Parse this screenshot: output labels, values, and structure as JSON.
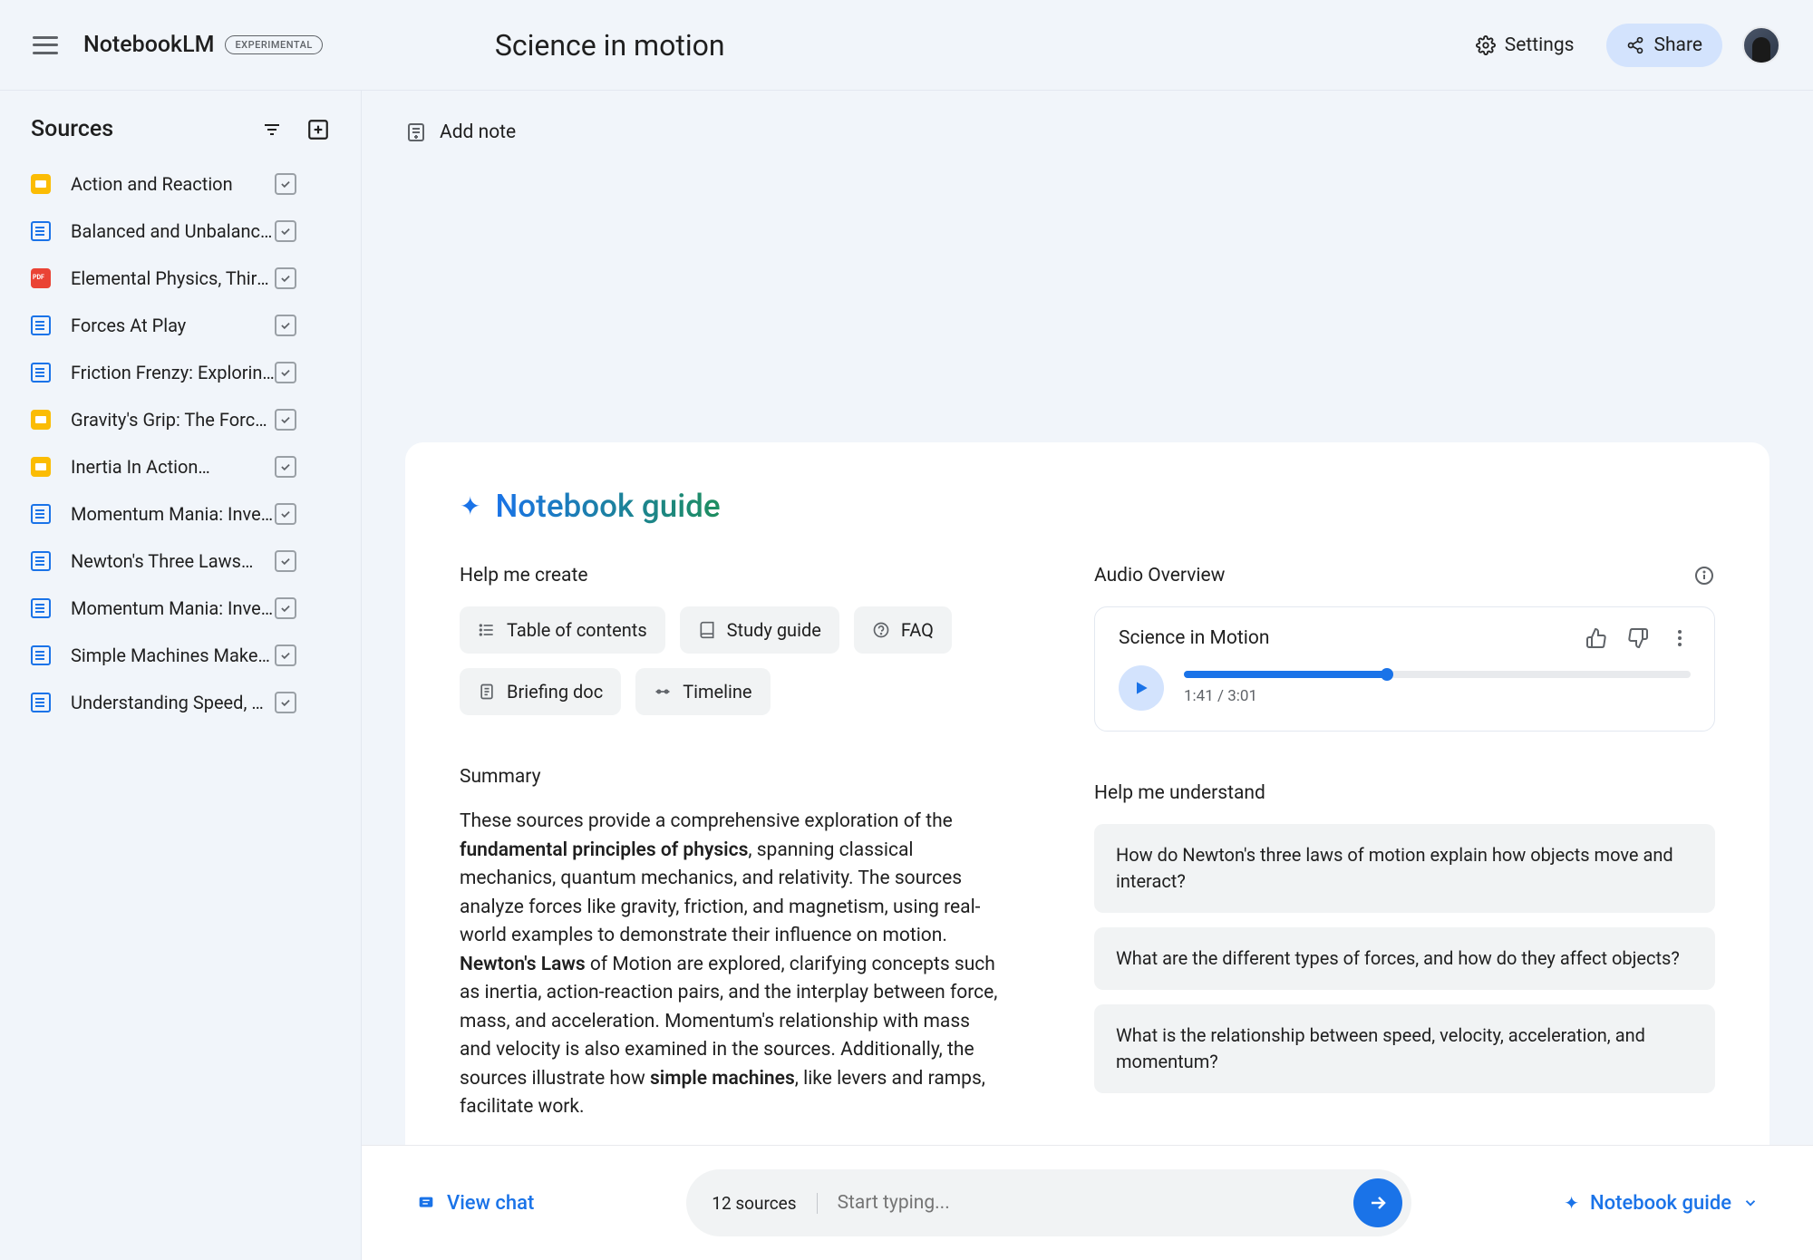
{
  "header": {
    "logo": "NotebookLM",
    "badge": "EXPERIMENTAL",
    "title": "Science in motion",
    "settings": "Settings",
    "share": "Share"
  },
  "sidebar": {
    "title": "Sources",
    "items": [
      {
        "label": "Action and Reaction",
        "type": "slides"
      },
      {
        "label": "Balanced and Unbalance…",
        "type": "doc"
      },
      {
        "label": "Elemental Physics, Third…",
        "type": "pdf"
      },
      {
        "label": "Forces At Play",
        "type": "doc"
      },
      {
        "label": "Friction Frenzy: Explorin…",
        "type": "doc"
      },
      {
        "label": "Gravity's Grip: The Force…",
        "type": "slides"
      },
      {
        "label": "Inertia In Action…",
        "type": "slides"
      },
      {
        "label": "Momentum Mania: Inves…",
        "type": "doc"
      },
      {
        "label": "Newton's Three Laws…",
        "type": "doc"
      },
      {
        "label": "Momentum Mania: Inves…",
        "type": "doc"
      },
      {
        "label": "Simple Machines Make…",
        "type": "doc"
      },
      {
        "label": "Understanding Speed, Ve…",
        "type": "doc"
      }
    ]
  },
  "main": {
    "add_note": "Add note",
    "guide_title": "Notebook guide",
    "help_create": "Help me create",
    "chips": {
      "toc": "Table of contents",
      "study": "Study guide",
      "faq": "FAQ",
      "brief": "Briefing doc",
      "timeline": "Timeline"
    },
    "summary_label": "Summary",
    "summary_parts": {
      "p1": "These sources provide a comprehensive exploration of the ",
      "b1": "fundamental principles of physics",
      "p2": ", spanning classical mechanics, quantum mechanics, and relativity. The sources analyze forces like gravity, friction, and magnetism, using real-world examples to demonstrate their influence on motion. ",
      "b2": "Newton's Laws",
      "p3": " of Motion are explored, clarifying concepts such as inertia, action-reaction pairs, and the interplay between force, mass, and acceleration. Momentum's relationship with mass and velocity is also examined in the sources. Additionally, the sources illustrate how ",
      "b3": "simple machines",
      "p4": ", like levers and ramps, facilitate work."
    },
    "audio_overview": "Audio Overview",
    "audio_title": "Science in Motion",
    "audio_time": "1:41 / 3:01",
    "help_understand": "Help me understand",
    "questions": [
      "How do Newton's three laws of motion explain how objects move and interact?",
      "What are the different types of forces, and how do they affect objects?",
      "What is the relationship between speed, velocity, acceleration, and momentum?"
    ]
  },
  "bottom": {
    "view_chat": "View chat",
    "sources_count": "12 sources",
    "placeholder": "Start typing...",
    "guide": "Notebook guide"
  }
}
